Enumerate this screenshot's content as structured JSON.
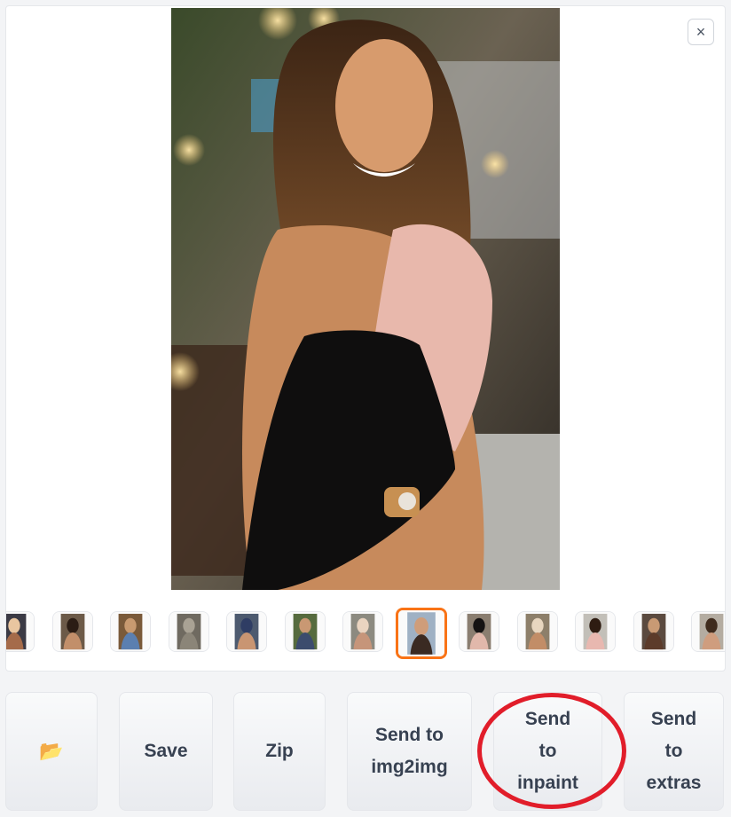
{
  "gallery": {
    "close_icon_glyph": "×",
    "thumbnail_count": 13,
    "selected_index": 7
  },
  "toolbar": {
    "open_folder": {
      "icon": "folder-icon",
      "glyph": "📂"
    },
    "save_label": "Save",
    "zip_label": "Zip",
    "send_img2img_label": "Send to\nimg2img",
    "send_inpaint_label": "Send\nto\ninpaint",
    "send_extras_label": "Send\nto\nextras"
  },
  "colors": {
    "selected_thumbnail_border": "#f97316",
    "annotation_circle": "#e11d2a",
    "button_text": "#374151"
  }
}
